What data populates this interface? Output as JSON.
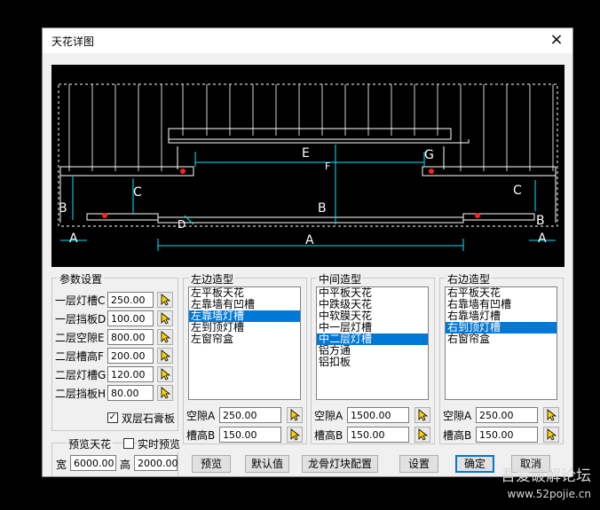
{
  "window": {
    "title": "天花详图",
    "close_glyph": "×"
  },
  "preview": {
    "dim_labels": {
      "E": "E",
      "F": "F",
      "G": "G",
      "C": "C",
      "B": "B",
      "D": "D",
      "A": "A"
    }
  },
  "params": {
    "group_label": "参数设置",
    "rows": [
      {
        "label": "一层灯槽C",
        "value": "250.00"
      },
      {
        "label": "一层挡板D",
        "value": "100.00"
      },
      {
        "label": "二层空隙E",
        "value": "800.00"
      },
      {
        "label": "二层槽高F",
        "value": "200.00"
      },
      {
        "label": "二层灯槽G",
        "value": "120.00"
      },
      {
        "label": "二层挡板H",
        "value": "80.00"
      }
    ],
    "double_gypsum": {
      "label": "双层石膏板",
      "checked": true
    }
  },
  "preview_settings": {
    "group_label": "预览天花",
    "realtime_label": "实时预览",
    "realtime_checked": false,
    "width_label": "宽",
    "width_value": "6000.00",
    "height_label": "高",
    "height_value": "2000.00"
  },
  "left": {
    "group_label": "左边造型",
    "items": [
      "左平板天花",
      "左靠墙有凹槽",
      "左靠墙灯槽",
      "左到顶灯槽",
      "左窗帘盒"
    ],
    "selected": 2,
    "gap_label": "空隙A",
    "gap_value": "250.00",
    "height_label": "槽高B",
    "height_value": "150.00"
  },
  "middle": {
    "group_label": "中间造型",
    "items": [
      "中平板天花",
      "中跌级天花",
      "中软膜天花",
      "中一层灯槽",
      "中二层灯槽",
      "铝方通",
      "铝扣板"
    ],
    "selected": 4,
    "gap_label": "空隙A",
    "gap_value": "1500.00",
    "height_label": "槽高B",
    "height_value": "150.00"
  },
  "right": {
    "group_label": "右边造型",
    "items": [
      "右平板天花",
      "右靠墙有凹槽",
      "右靠墙灯槽",
      "右到顶灯槽",
      "右窗帘盒"
    ],
    "selected": 3,
    "gap_label": "空隙A",
    "gap_value": "250.00",
    "height_label": "槽高B",
    "height_value": "150.00"
  },
  "buttons": {
    "preview": "预览",
    "default": "默认值",
    "keel": "龙骨灯块配置",
    "settings": "设置",
    "ok": "确定",
    "cancel": "取消"
  },
  "watermark": {
    "name": "吾爱破解论坛",
    "url": "www.52pojie.cn"
  },
  "colors": {
    "cad_bg": "#000000",
    "cad_cyan": "#00e5ff",
    "cad_white": "#ffffff",
    "cad_red": "#ff2020",
    "selection": "#0078d7"
  }
}
